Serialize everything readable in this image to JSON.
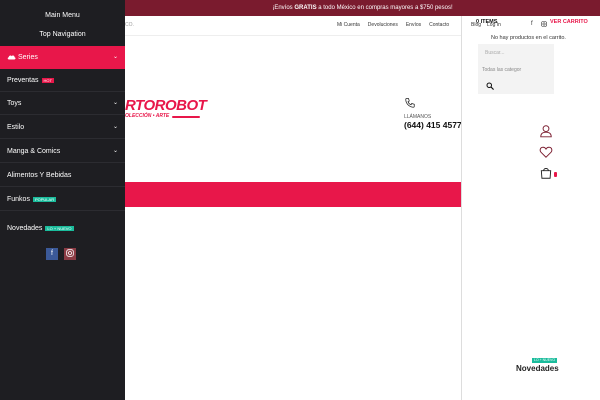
{
  "promo": {
    "prefix": "¡Envíos ",
    "bold": "GRATIS",
    "suffix": " a todo México en compras mayores a $750 pesos!"
  },
  "header": {
    "left_text": "CO.",
    "links": [
      "Mi Cuenta",
      "Devoluciones",
      "Envíos",
      "Contacto"
    ],
    "blog": "Blog",
    "login": "Log In"
  },
  "logo": {
    "text": "RTOROBOT",
    "tagline": "OLECCIÓN • ARTE"
  },
  "phone": {
    "label": "LLÁMANOS",
    "number": "(644) 415 4577"
  },
  "cart": {
    "items_label": "0 ITEMS",
    "view_cart": "VER CARRITO",
    "empty_message": "No hay productos en el carrito.",
    "search_placeholder": "Buscar...",
    "category_select": "Todas las categor"
  },
  "sidebar": {
    "main_menu": "Main Menu",
    "top_navigation": "Top Navigation",
    "items": [
      {
        "label": "Series",
        "badge": "",
        "has_children": true
      },
      {
        "label": "Preventas",
        "badge": "HOT",
        "has_children": false
      },
      {
        "label": "Toys",
        "badge": "",
        "has_children": true
      },
      {
        "label": "Estilo",
        "badge": "",
        "has_children": true
      },
      {
        "label": "Manga & Comics",
        "badge": "",
        "has_children": true
      },
      {
        "label": "Alimentos Y Bebidas",
        "badge": "",
        "has_children": false
      },
      {
        "label": "Funkos",
        "badge": "POPULAR",
        "has_children": false
      },
      {
        "label": "Novedades",
        "badge": "LO + NUEVO",
        "has_children": false
      }
    ]
  },
  "novedades_block": {
    "badge": "LO + NUEVO",
    "label": "Novedades"
  },
  "colors": {
    "accent": "#e8174a",
    "promo_bar": "#7a1b2e",
    "sidebar_bg": "#1e1e22",
    "badge_green": "#1abc9c"
  },
  "icons": [
    "bars-icon",
    "phone-icon",
    "search-icon",
    "user-icon",
    "heart-icon",
    "cart-icon",
    "facebook-icon",
    "instagram-icon",
    "chevron-down-icon",
    "series-cloud-icon"
  ]
}
